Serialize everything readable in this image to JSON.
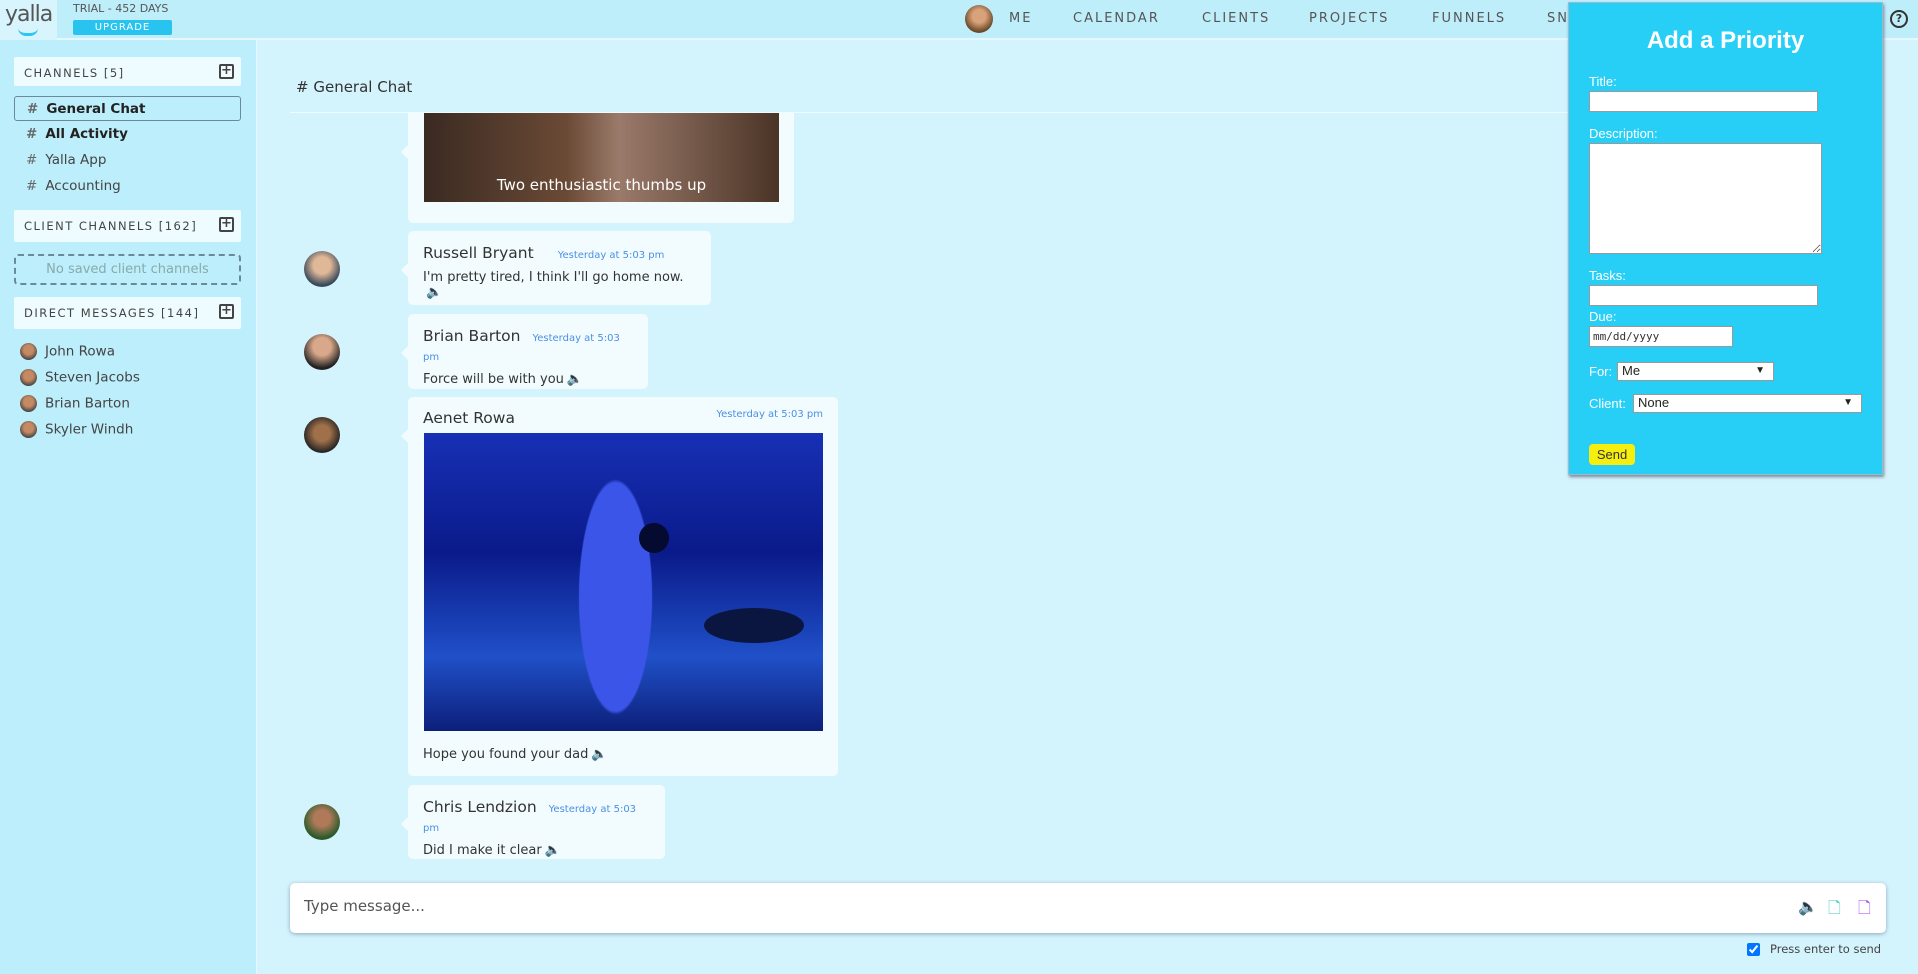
{
  "app": {
    "logo": "yalla",
    "trial": "TRIAL - 452 DAYS",
    "upgrade": "UPGRADE"
  },
  "nav": [
    "ME",
    "CALENDAR",
    "CLIENTS",
    "PROJECTS",
    "FUNNELS",
    "SN"
  ],
  "sidebar": {
    "channels_header": "CHANNELS [5]",
    "channels": [
      "General Chat",
      "All Activity",
      "Yalla App",
      "Accounting"
    ],
    "client_header": "CLIENT CHANNELS [162]",
    "client_empty": "No saved client channels",
    "dm_header": "DIRECT MESSAGES [144]",
    "dms": [
      "John Rowa",
      "Steven Jacobs",
      "Brian Barton",
      "Skyler Windh"
    ]
  },
  "channel": {
    "title": "# General Chat"
  },
  "messages": [
    {
      "caption": "Two enthusiastic thumbs up"
    },
    {
      "name": "Russell Bryant",
      "time": "Yesterday at 5:03 pm",
      "text": "I'm pretty tired, I think I'll go home now."
    },
    {
      "name": "Brian Barton",
      "time": "Yesterday at 5:03 pm",
      "text": "Force will be with you"
    },
    {
      "name": "Aenet Rowa",
      "time": "Yesterday at 5:03 pm",
      "text": "Hope you found your dad"
    },
    {
      "name": "Chris Lendzion",
      "time": "Yesterday at 5:03 pm",
      "text": "Did I make it clear"
    }
  ],
  "composer": {
    "placeholder": "Type message...",
    "press_enter": "Press enter to send",
    "press_enter_checked": true
  },
  "popup": {
    "title": "Add a Priority",
    "title_label": "Title:",
    "description_label": "Description:",
    "tasks_label": "Tasks:",
    "due_label": "Due:",
    "due_placeholder": "mm/dd/yyyy",
    "for_label": "For:",
    "for_value": "Me",
    "client_label": "Client:",
    "client_value": "None",
    "send": "Send"
  },
  "colors": {
    "accent": "#27cff7",
    "send_button": "#f6ee0e",
    "timestamp": "#4a90e2"
  }
}
